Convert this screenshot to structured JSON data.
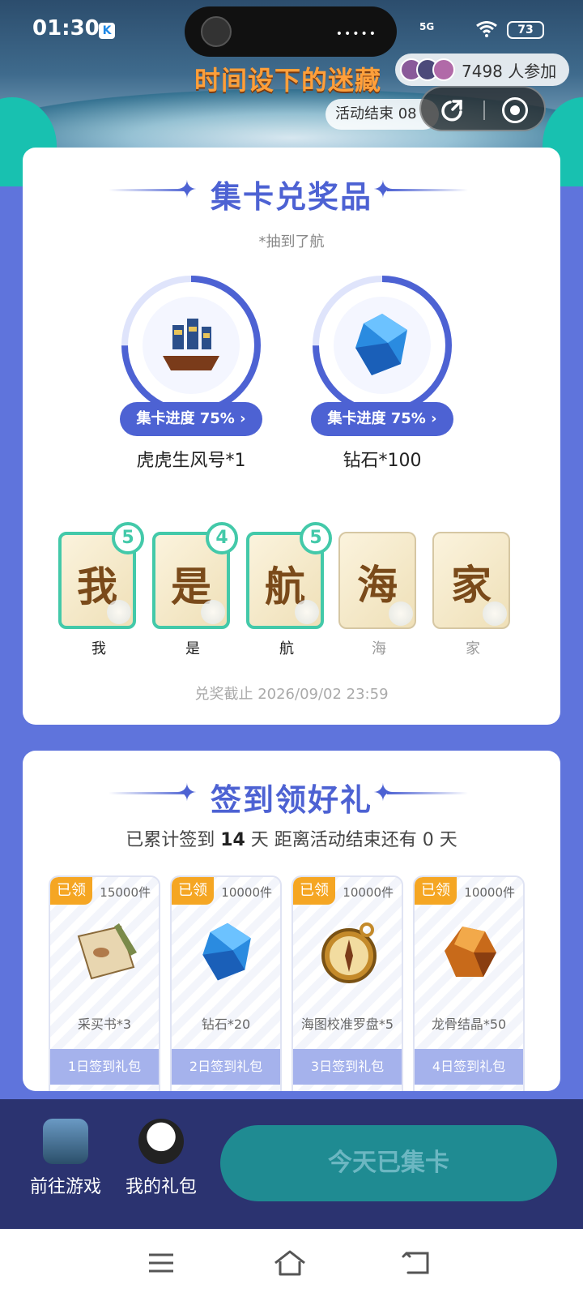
{
  "status": {
    "time": "01:30",
    "k_badge": "K",
    "signal": "5G",
    "battery": "73",
    "dots": "•••••"
  },
  "header": {
    "event_title": "时间设下的迷藏",
    "participants": "7498 人参加",
    "end_text": "活动结束 08"
  },
  "collect": {
    "title": "集卡兑奖品",
    "note_top": "*抽到了航",
    "prizes": [
      {
        "progress_label": "集卡进度 75% ›",
        "progress": 0.75,
        "name": "虎虎生风号*1",
        "icon": "ship-icon"
      },
      {
        "progress_label": "集卡进度 75% ›",
        "progress": 0.75,
        "name": "钻石*100",
        "icon": "diamond-icon"
      }
    ],
    "cards": [
      {
        "glyph": "我",
        "label": "我",
        "count": "5",
        "owned": true
      },
      {
        "glyph": "是",
        "label": "是",
        "count": "4",
        "owned": true
      },
      {
        "glyph": "航",
        "label": "航",
        "count": "5",
        "owned": true
      },
      {
        "glyph": "海",
        "label": "海",
        "count": "",
        "owned": false
      },
      {
        "glyph": "家",
        "label": "家",
        "count": "",
        "owned": false
      }
    ],
    "deadline": "兑奖截止 2026/09/02 23:59"
  },
  "checkin": {
    "title": "签到领好礼",
    "summary_prefix": "已累计签到 ",
    "summary_days": "14",
    "summary_suffix": " 天  距离活动结束还有 0 天",
    "gifts": [
      {
        "claimed": "已领",
        "stock": "15000件",
        "name": "采买书*3",
        "day": "1日签到礼包",
        "icon": "scroll-icon"
      },
      {
        "claimed": "已领",
        "stock": "10000件",
        "name": "钻石*20",
        "day": "2日签到礼包",
        "icon": "diamond-icon"
      },
      {
        "claimed": "已领",
        "stock": "10000件",
        "name": "海图校准罗盘*5",
        "day": "3日签到礼包",
        "icon": "compass-icon"
      },
      {
        "claimed": "已领",
        "stock": "10000件",
        "name": "龙骨结晶*50",
        "day": "4日签到礼包",
        "icon": "crystal-icon"
      }
    ]
  },
  "actions": {
    "go_game": "前往游戏",
    "my_gifts": "我的礼包",
    "collect_button": "今天已集卡"
  },
  "colors": {
    "accent": "#4d62d3",
    "teal": "#43c9a9",
    "claimed": "#f5a623",
    "bar": "#2b3370"
  }
}
